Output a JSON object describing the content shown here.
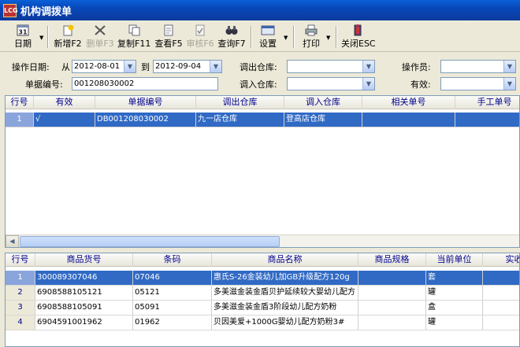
{
  "window": {
    "title": "机构调拨单",
    "icon_text": "LCG"
  },
  "toolbar": {
    "date": "日期",
    "add": "新增F2",
    "delete": "删单F3",
    "copy": "复制F11",
    "view": "查看F5",
    "audit": "审核F6",
    "query": "查询F7",
    "settings": "设置",
    "print": "打印",
    "close": "关闭ESC"
  },
  "filter": {
    "op_date_label": "操作日期:",
    "from_label": "从",
    "from_value": "2012-08-01",
    "to_label": "到",
    "to_value": "2012-09-04",
    "out_wh_label": "调出仓库:",
    "out_wh_value": "",
    "operator_label": "操作员:",
    "operator_value": "",
    "doc_no_label": "单据编号:",
    "doc_no_value": "001208030002",
    "in_wh_label": "调入仓库:",
    "in_wh_value": "",
    "valid_label": "有效:",
    "valid_value": ""
  },
  "top_grid": {
    "columns": [
      "行号",
      "有效",
      "单据编号",
      "调出仓库",
      "调入仓库",
      "相关单号",
      "手工单号"
    ],
    "rows": [
      {
        "row": "1",
        "valid": "√",
        "doc_no": "DB001208030002",
        "out_wh": "九一店仓库",
        "in_wh": "登高店仓库",
        "related": "",
        "manual": ""
      }
    ]
  },
  "bottom_grid": {
    "columns": [
      "行号",
      "商品货号",
      "条码",
      "商品名称",
      "商品规格",
      "当前单位",
      "实收"
    ],
    "rows": [
      {
        "row": "1",
        "code": "300089307046",
        "barcode": "07046",
        "name": "惠氏S-26金装幼儿加GB升级配方120g",
        "spec": "",
        "unit": "套"
      },
      {
        "row": "2",
        "code": "6908588105121",
        "barcode": "05121",
        "name": "多美滋金装金盾贝护延续较大婴幼儿配方",
        "spec": "",
        "unit": "罐"
      },
      {
        "row": "3",
        "code": "6908588105091",
        "barcode": "05091",
        "name": "多美滋金装金盾3阶段幼儿配方奶粉",
        "spec": "",
        "unit": "盒"
      },
      {
        "row": "4",
        "code": "6904591001962",
        "barcode": "01962",
        "name": "贝因美爱+1000G婴幼儿配方奶粉3#",
        "spec": "",
        "unit": "罐"
      }
    ]
  },
  "colors": {
    "title_bar": "#0a47b8",
    "selection": "#316ac5",
    "header_text": "#00008b",
    "window_bg": "#ece9d8"
  },
  "icons": [
    "calendar-icon",
    "new-doc-icon",
    "delete-x-icon",
    "copy-icon",
    "view-icon",
    "audit-icon",
    "binoculars-icon",
    "settings-icon",
    "printer-icon",
    "close-exit-icon"
  ]
}
